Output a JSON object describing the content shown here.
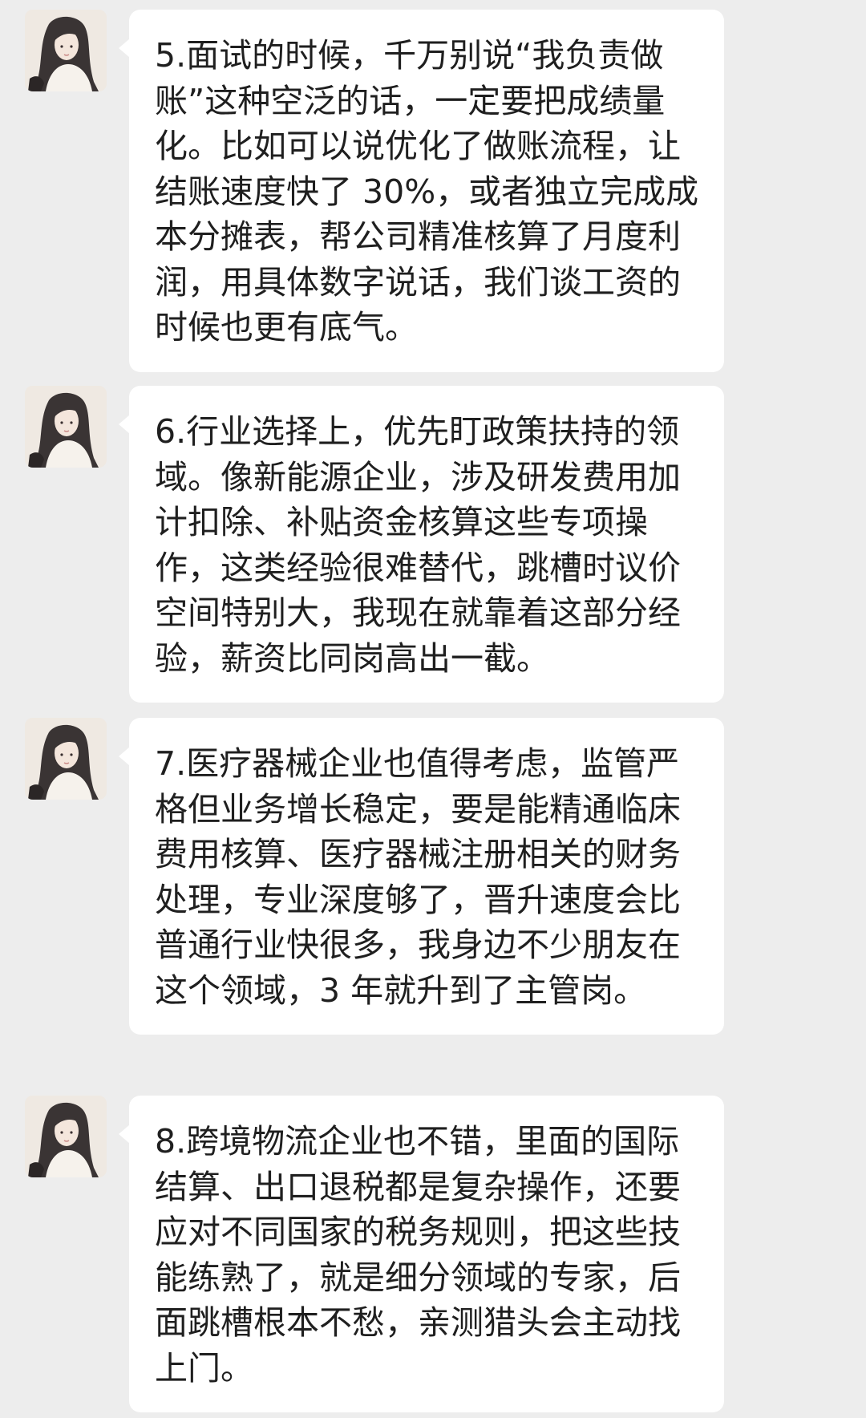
{
  "chat": {
    "messages": [
      {
        "sender_avatar": "girl-portrait-avatar",
        "text": "5.面试的时候，千万别说“我负责做账”这种空泛的话，一定要把成绩量化。比如可以说优化了做账流程，让结账速度快了 30%，或者独立完成成本分摊表，帮公司精准核算了月度利润，用具体数字说话，我们谈工资的时候也更有底气。"
      },
      {
        "sender_avatar": "girl-portrait-avatar",
        "text": "6.行业选择上，优先盯政策扶持的领域。像新能源企业，涉及研发费用加计扣除、补贴资金核算这些专项操作，这类经验很难替代，跳槽时议价空间特别大，我现在就靠着这部分经验，薪资比同岗高出一截。"
      },
      {
        "sender_avatar": "girl-portrait-avatar",
        "text": "7.医疗器械企业也值得考虑，监管严格但业务增长稳定，要是能精通临床费用核算、医疗器械注册相关的财务处理，专业深度够了，晋升速度会比普通行业快很多，我身边不少朋友在这个领域，3 年就升到了主管岗。"
      },
      {
        "sender_avatar": "girl-portrait-avatar",
        "text": "8.跨境物流企业也不错，里面的国际结算、出口退税都是复杂操作，还要应对不同国家的税务规则，把这些技能练熟了，就是细分领域的专家，后面跳槽根本不愁，亲测猎头会主动找上门。"
      }
    ]
  },
  "colors": {
    "background": "#ededed",
    "bubble": "#ffffff",
    "text": "#1f1f1f"
  }
}
